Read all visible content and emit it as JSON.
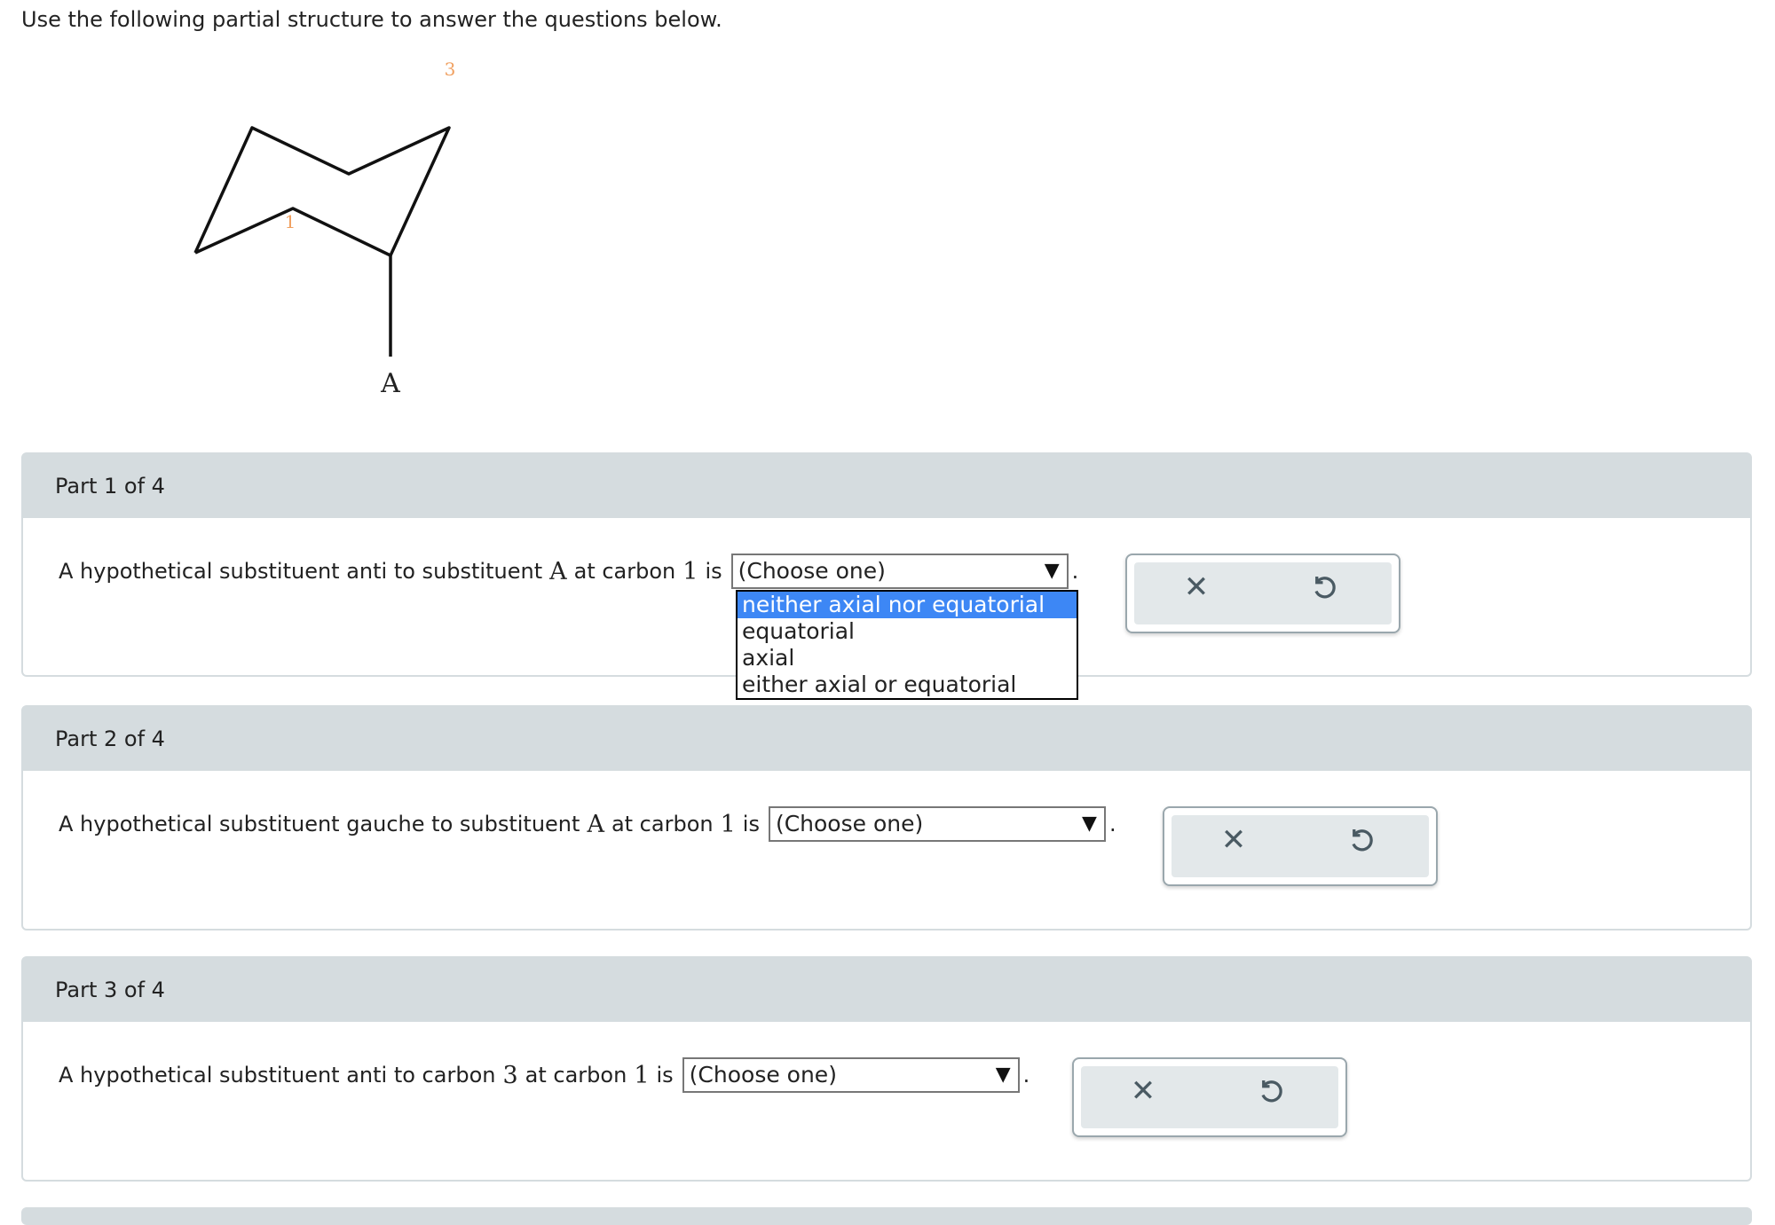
{
  "intro_text": "Use the following partial structure to answer the questions below.",
  "structure": {
    "label_carbon1": "1",
    "label_carbon3": "3",
    "label_substituent": "A",
    "label_color": "#f0a060"
  },
  "parts": [
    {
      "header": "Part 1 of 4",
      "q_prefix": "A hypothetical substituent anti to substituent",
      "q_sym1": "A",
      "q_mid": "at carbon",
      "q_sym2": "1",
      "q_suffix": "is",
      "select_value": "(Choose one)"
    },
    {
      "header": "Part 2 of 4",
      "q_prefix": "A hypothetical substituent gauche to substituent",
      "q_sym1": "A",
      "q_mid": "at carbon",
      "q_sym2": "1",
      "q_suffix": "is",
      "select_value": "(Choose one)"
    },
    {
      "header": "Part 3 of 4",
      "q_prefix": "A hypothetical substituent anti to carbon",
      "q_sym1": "3",
      "q_mid": "at carbon",
      "q_sym2": "1",
      "q_suffix": "is",
      "select_value": "(Choose one)"
    }
  ],
  "dropdown_options": [
    "neither axial nor equatorial",
    "equatorial",
    "axial",
    "either axial or equatorial"
  ],
  "highlight_color": "#3d87f5",
  "icons": {
    "clear": "x-icon",
    "reset": "undo-icon"
  },
  "punct": "."
}
